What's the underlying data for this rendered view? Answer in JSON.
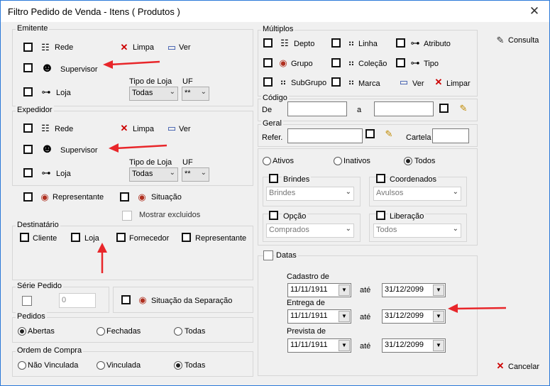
{
  "window": {
    "title": "Filtro Pedido de Venda - Itens ( Produtos )",
    "close": "✕"
  },
  "emitente": {
    "title": "Emitente",
    "rede": "Rede",
    "limpa": "Limpa",
    "ver": "Ver",
    "supervisor": "Supervisor",
    "tipo_loja_label": "Tipo de Loja",
    "uf_label": "UF",
    "loja": "Loja",
    "tipo_loja_value": "Todas",
    "uf_value": "**"
  },
  "expedidor": {
    "title": "Expedidor",
    "rede": "Rede",
    "limpa": "Limpa",
    "ver": "Ver",
    "supervisor": "Supervisor",
    "tipo_loja_label": "Tipo de Loja",
    "uf_label": "UF",
    "loja": "Loja",
    "tipo_loja_value": "Todas",
    "uf_value": "**"
  },
  "misc": {
    "representante": "Representante",
    "situacao": "Situação",
    "mostrar_excluidos": "Mostrar excluidos"
  },
  "destinatario": {
    "title": "Destinatário",
    "cliente": "Cliente",
    "loja": "Loja",
    "fornecedor": "Fornecedor",
    "representante": "Representante"
  },
  "serie": {
    "title": "Série Pedido",
    "value": "0",
    "situacao_separacao": "Situação da Separação"
  },
  "pedidos": {
    "title": "Pedidos",
    "abertas": "Abertas",
    "fechadas": "Fechadas",
    "todas": "Todas",
    "selected": "Abertas"
  },
  "ordem": {
    "title": "Ordem de Compra",
    "nao_vinculada": "Não Vinculada",
    "vinculada": "Vinculada",
    "todas": "Todas",
    "selected": "Todas"
  },
  "multiplos": {
    "title": "Múltiplos",
    "depto": "Depto",
    "linha": "Linha",
    "atributo": "Atributo",
    "grupo": "Grupo",
    "colecao": "Coleção",
    "tipo": "Tipo",
    "subgrupo": "SubGrupo",
    "marca": "Marca",
    "ver": "Ver",
    "limpar": "Limpar"
  },
  "codigo": {
    "title": "Código",
    "de": "De",
    "ate": "a"
  },
  "geral": {
    "title": "Geral",
    "refer": "Refer.",
    "cartela": "Cartela"
  },
  "status": {
    "ativos": "Ativos",
    "inativos": "Inativos",
    "todos": "Todos",
    "selected": "Todos"
  },
  "brindes": {
    "title": "Brindes",
    "value": "Brindes"
  },
  "coordenados": {
    "title": "Coordenados",
    "value": "Avulsos"
  },
  "opcao": {
    "title": "Opção",
    "value": "Comprados"
  },
  "liberacao": {
    "title": "Liberação",
    "value": "Todos"
  },
  "datas": {
    "title": "Datas",
    "cadastro": "Cadastro de",
    "entrega": "Entrega de",
    "prevista": "Prevista de",
    "ate": "até",
    "cad_de": "11/11/1911",
    "cad_ate": "31/12/2099",
    "ent_de": "11/11/1911",
    "ent_ate": "31/12/2099",
    "prev_de": "11/11/1911",
    "prev_ate": "31/12/2099"
  },
  "buttons": {
    "consulta": "Consulta",
    "cancelar": "Cancelar"
  },
  "colors": {
    "arrow": "#e8262a",
    "border": "#2b79d8"
  }
}
